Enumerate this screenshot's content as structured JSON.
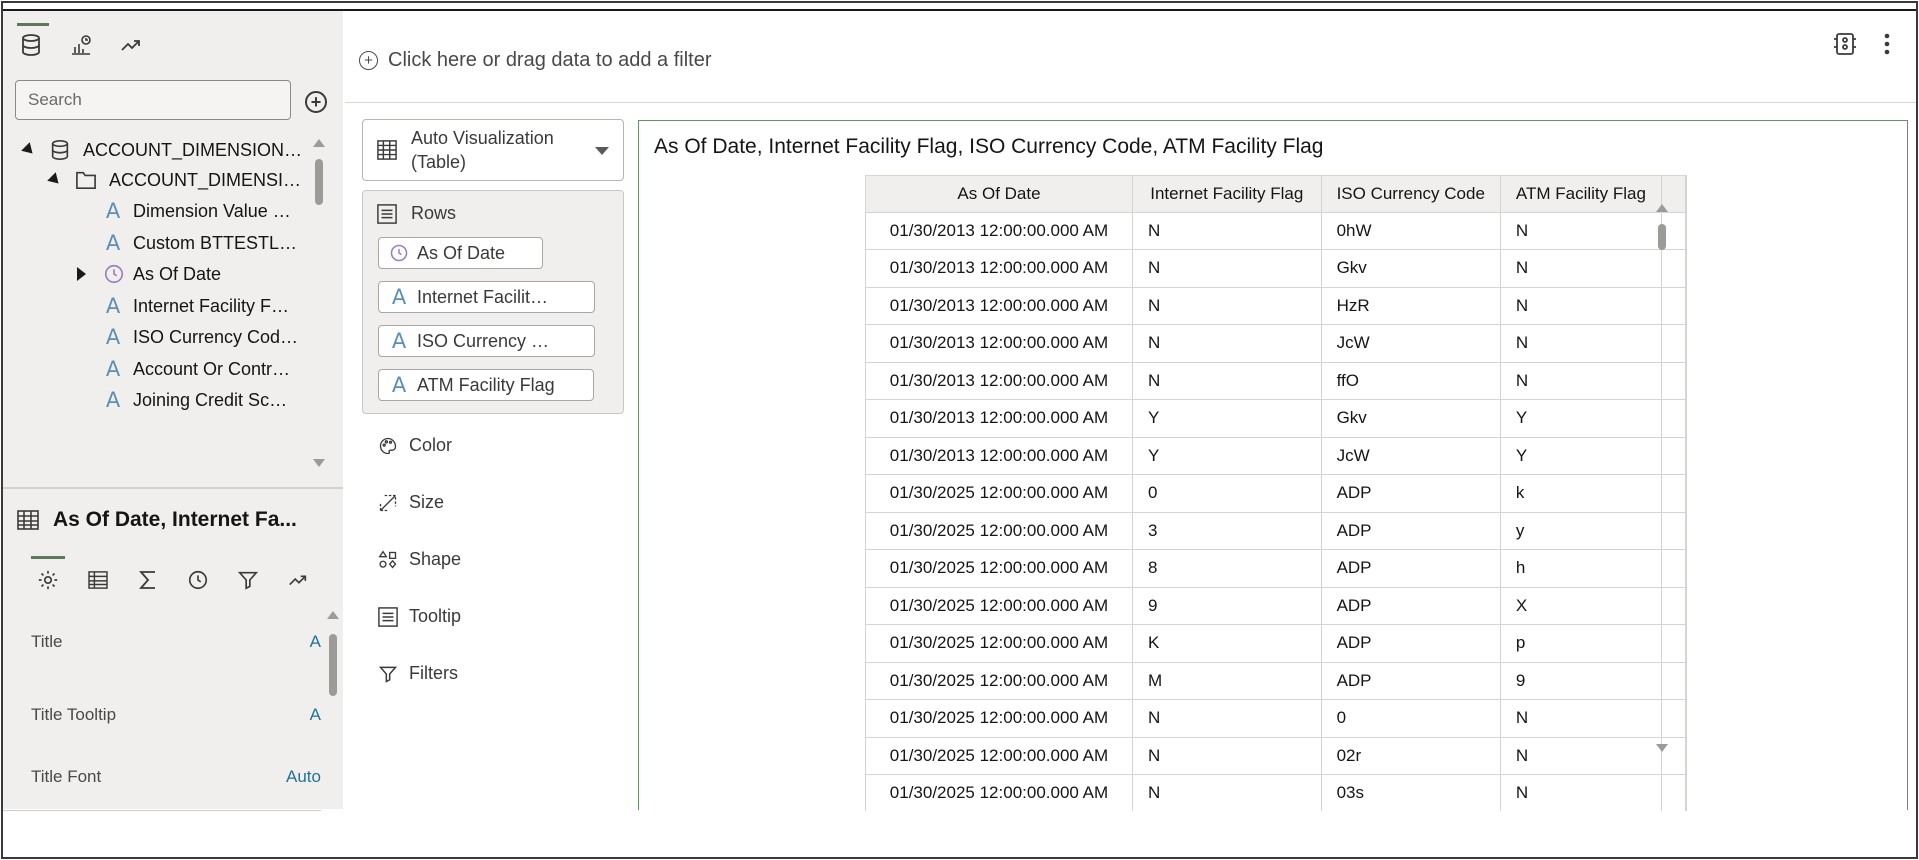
{
  "left_panel": {
    "tabs": [
      {
        "icon": "database-icon",
        "active": true
      },
      {
        "icon": "chart-analytics-icon",
        "active": false
      },
      {
        "icon": "trend-line-icon",
        "active": false
      }
    ],
    "search": {
      "placeholder": "Search"
    },
    "tree": [
      {
        "label": "ACCOUNT_DIMENSION…",
        "icon": "database-icon",
        "expanded": true,
        "level": 0
      },
      {
        "label": "ACCOUNT_DIMENSI…",
        "icon": "folder-icon",
        "expanded": true,
        "level": 1
      },
      {
        "label": "Dimension Value …",
        "icon": "attribute-icon",
        "level": 2
      },
      {
        "label": "Custom BTTESTL…",
        "icon": "attribute-icon",
        "level": 2
      },
      {
        "label": "As Of Date",
        "icon": "clock-icon",
        "expandable": true,
        "level": 2
      },
      {
        "label": "Internet Facility F…",
        "icon": "attribute-icon",
        "level": 2
      },
      {
        "label": "ISO Currency Cod…",
        "icon": "attribute-icon",
        "level": 2
      },
      {
        "label": "Account Or Contr…",
        "icon": "attribute-icon",
        "level": 2
      },
      {
        "label": "Joining Credit Sc…",
        "icon": "attribute-icon",
        "level": 2
      }
    ],
    "properties": {
      "title": "As Of Date, Internet Fa...",
      "tabs": [
        "gear-icon",
        "table-icon",
        "sigma-icon",
        "clock-icon",
        "filter-icon",
        "trend-line-icon"
      ],
      "rows": [
        {
          "label": "Title",
          "value": "A"
        },
        {
          "label": "Title Tooltip",
          "value": "A"
        },
        {
          "label": "Title Font",
          "value": "Auto"
        }
      ]
    }
  },
  "filter_bar": {
    "prompt": "Click here or drag data to add a filter"
  },
  "grammar": {
    "viz_type": "Auto Visualization (Table)",
    "rows_label": "Rows",
    "row_pills": [
      "As Of Date",
      "Internet Facilit…",
      "ISO Currency …",
      "ATM Facility Flag"
    ],
    "sections": [
      "Color",
      "Size",
      "Shape",
      "Tooltip",
      "Filters"
    ]
  },
  "canvas": {
    "title": "As Of Date, Internet Facility Flag, ISO Currency Code, ATM Facility Flag",
    "columns": [
      "As Of Date",
      "Internet Facility Flag",
      "ISO Currency Code",
      "ATM Facility Flag"
    ],
    "rows": [
      [
        "01/30/2013 12:00:00.000 AM",
        "N",
        "0hW",
        "N"
      ],
      [
        "01/30/2013 12:00:00.000 AM",
        "N",
        "Gkv",
        "N"
      ],
      [
        "01/30/2013 12:00:00.000 AM",
        "N",
        "HzR",
        "N"
      ],
      [
        "01/30/2013 12:00:00.000 AM",
        "N",
        "JcW",
        "N"
      ],
      [
        "01/30/2013 12:00:00.000 AM",
        "N",
        "ffO",
        "N"
      ],
      [
        "01/30/2013 12:00:00.000 AM",
        "Y",
        "Gkv",
        "Y"
      ],
      [
        "01/30/2013 12:00:00.000 AM",
        "Y",
        "JcW",
        "Y"
      ],
      [
        "01/30/2025 12:00:00.000 AM",
        "0",
        "ADP",
        "k"
      ],
      [
        "01/30/2025 12:00:00.000 AM",
        "3",
        "ADP",
        "y"
      ],
      [
        "01/30/2025 12:00:00.000 AM",
        "8",
        "ADP",
        "h"
      ],
      [
        "01/30/2025 12:00:00.000 AM",
        "9",
        "ADP",
        "X"
      ],
      [
        "01/30/2025 12:00:00.000 AM",
        "K",
        "ADP",
        "p"
      ],
      [
        "01/30/2025 12:00:00.000 AM",
        "M",
        "ADP",
        "9"
      ],
      [
        "01/30/2025 12:00:00.000 AM",
        "N",
        "0",
        "N"
      ],
      [
        "01/30/2025 12:00:00.000 AM",
        "N",
        "02r",
        "N"
      ],
      [
        "01/30/2025 12:00:00.000 AM",
        "N",
        "03s",
        "N"
      ]
    ]
  },
  "colors": {
    "accent": "#5c7a5a",
    "link": "#227399",
    "attribute": "#5c8fb3",
    "panel_bg": "#f1efed"
  }
}
